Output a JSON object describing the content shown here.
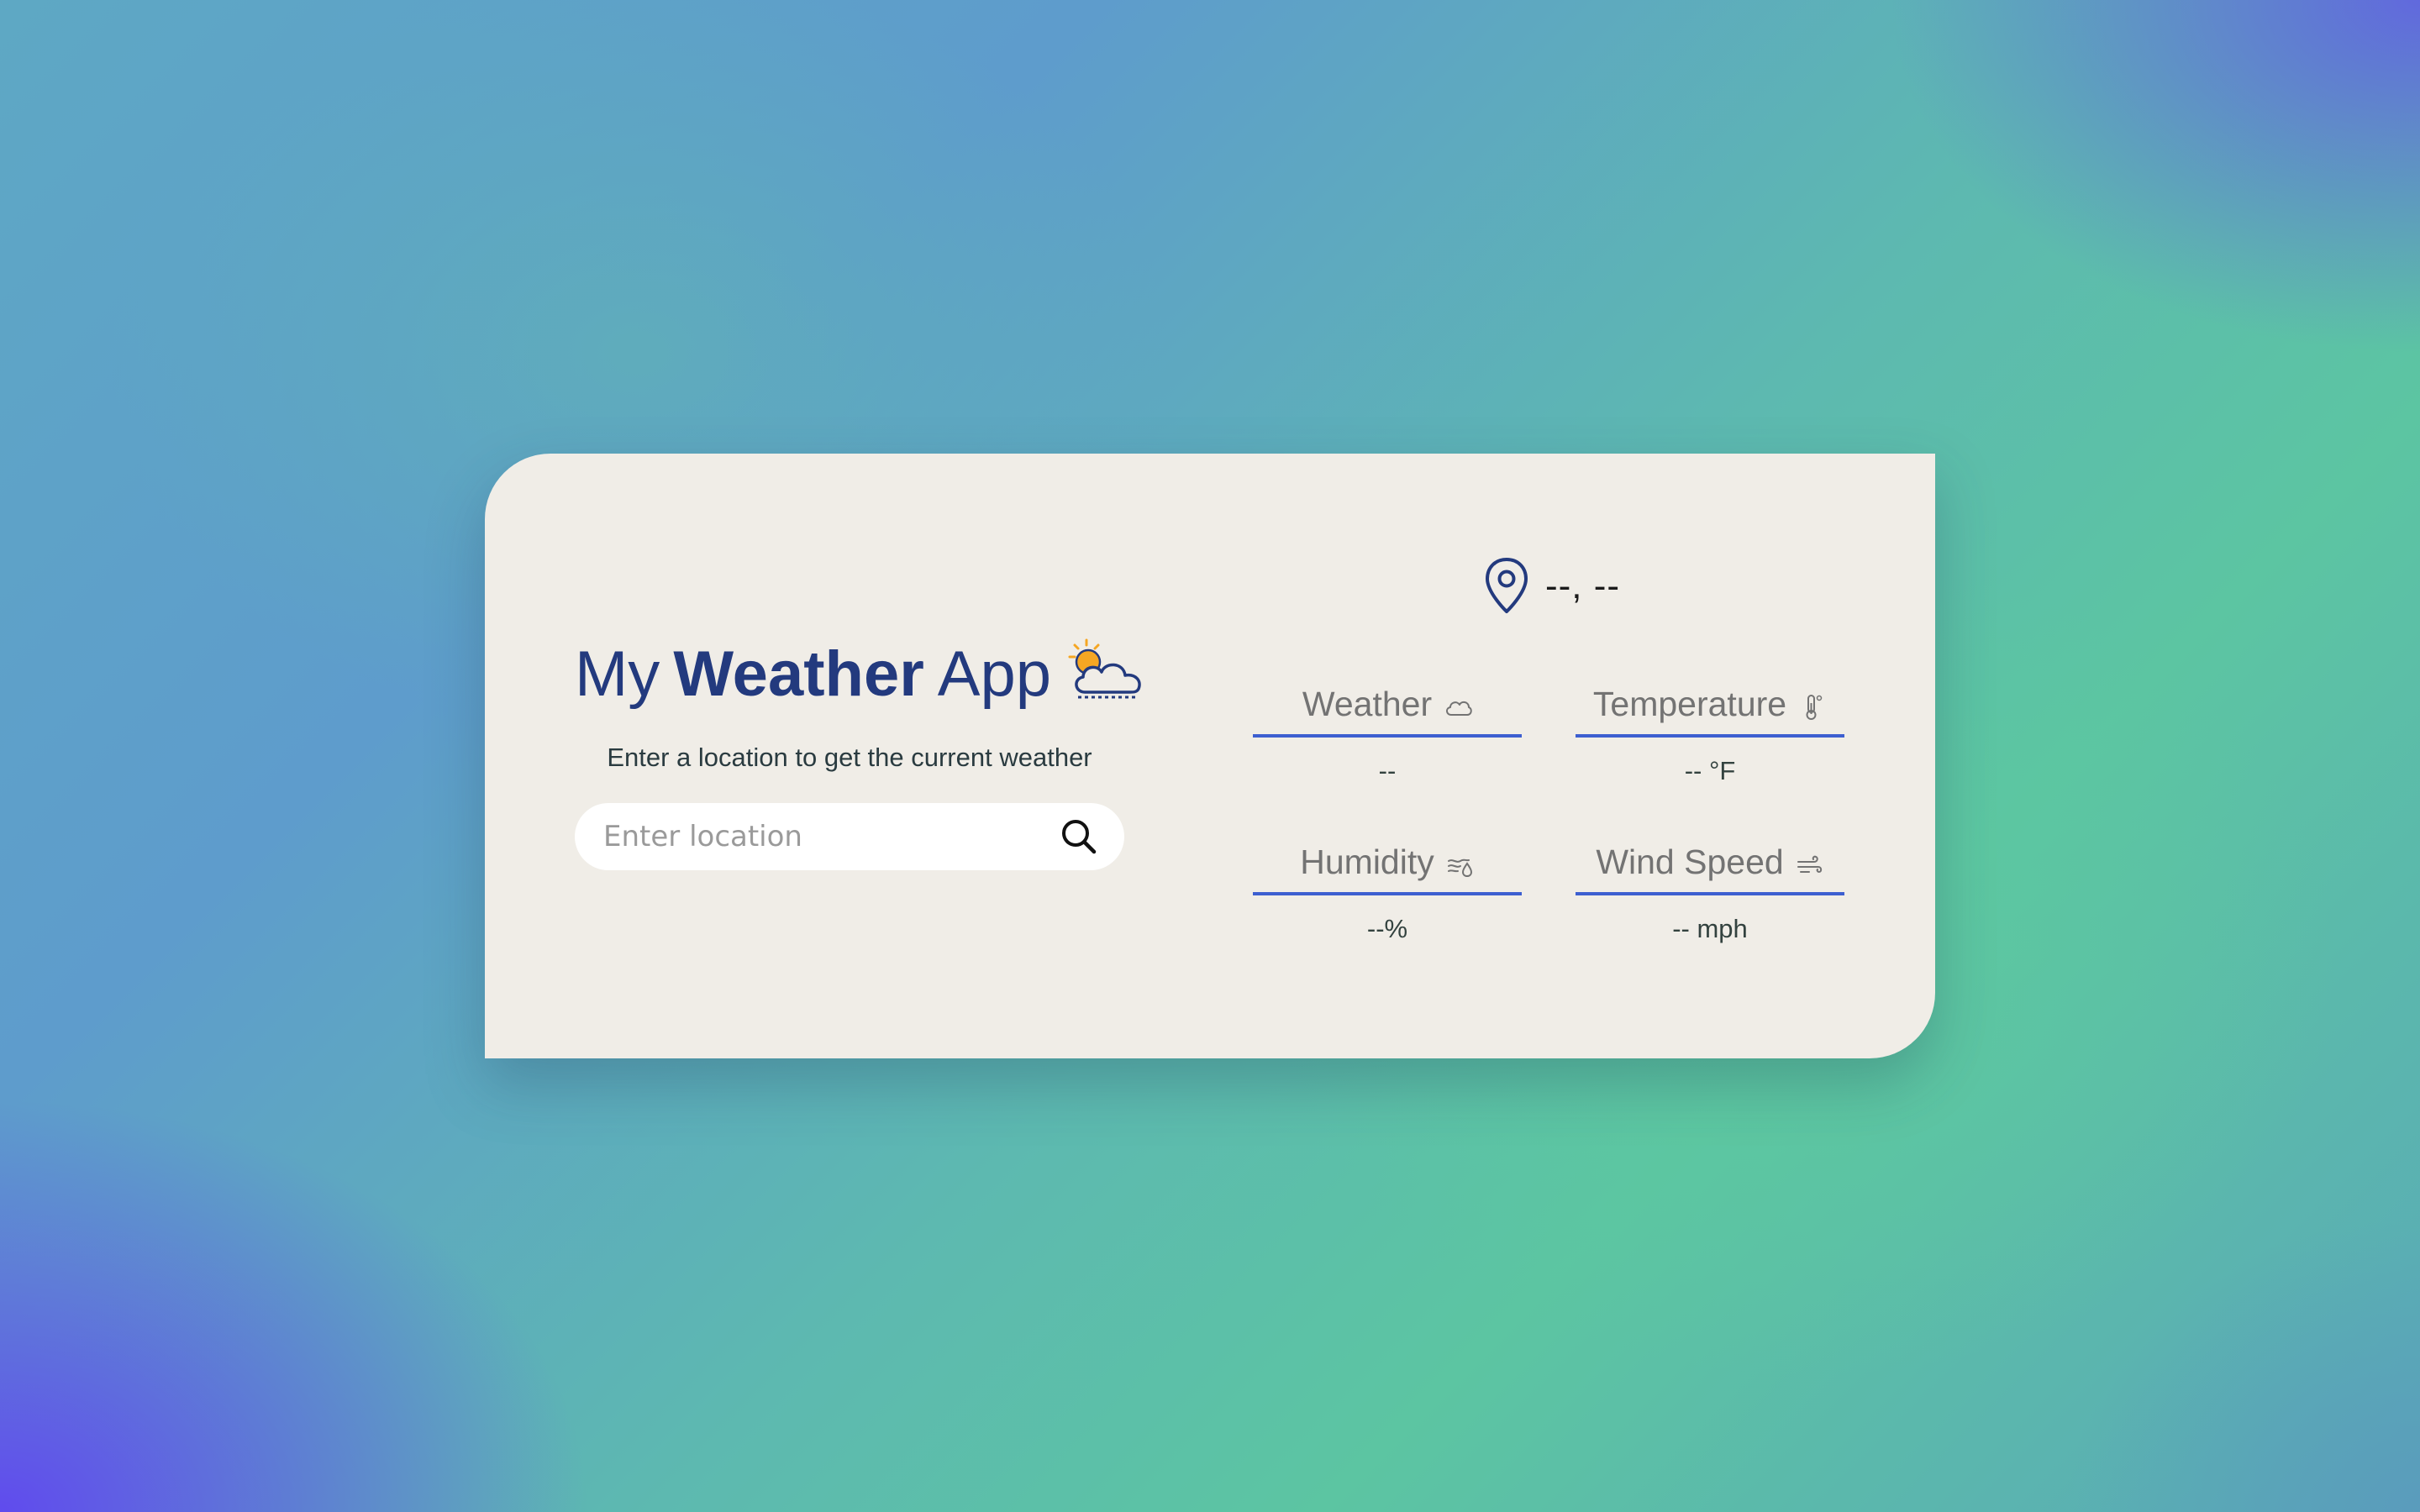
{
  "app": {
    "title_my": "My",
    "title_weather": "Weather",
    "title_app": "App",
    "title_icon": "sun-behind-cloud-icon",
    "subtitle": "Enter a location to get the current weather"
  },
  "search": {
    "placeholder": "Enter location",
    "value": "",
    "button_icon": "search-icon"
  },
  "location": {
    "icon": "map-pin-icon",
    "text": "--, --"
  },
  "stats": [
    {
      "label": "Weather",
      "icon": "cloud-icon",
      "value": "--"
    },
    {
      "label": "Temperature",
      "icon": "thermometer-icon",
      "value": "-- °F"
    },
    {
      "label": "Humidity",
      "icon": "humidity-icon",
      "value": "--%"
    },
    {
      "label": "Wind Speed",
      "icon": "wind-icon",
      "value": "-- mph"
    }
  ],
  "colors": {
    "brand_navy": "#233a7e",
    "accent_blue": "#3d5fd0",
    "card_bg": "#f0ede7",
    "sun_orange": "#f5a623"
  }
}
